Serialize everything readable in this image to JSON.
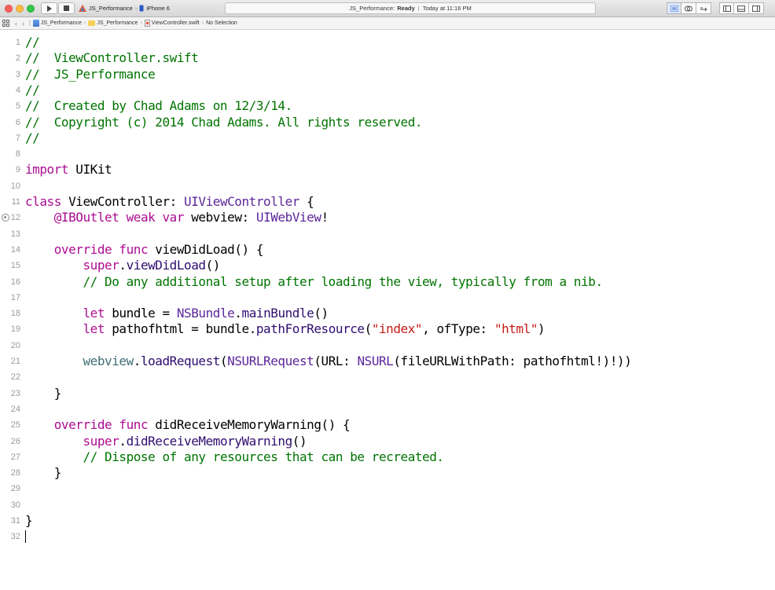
{
  "window": {
    "scheme_target": "JS_Performance",
    "scheme_device": "iPhone 6",
    "status_project": "JS_Performance:",
    "status_state": "Ready",
    "status_separator": "|",
    "status_time": "Today at 11:16 PM"
  },
  "jumpbar": {
    "crumbs": [
      "JS_Performance",
      "JS_Performance",
      "ViewController.swift",
      "No Selection"
    ]
  },
  "editor": {
    "lines": [
      {
        "n": "1",
        "t": [
          {
            "c": "cmt",
            "s": "//"
          }
        ]
      },
      {
        "n": "2",
        "t": [
          {
            "c": "cmt",
            "s": "//  ViewController.swift"
          }
        ]
      },
      {
        "n": "3",
        "t": [
          {
            "c": "cmt",
            "s": "//  JS_Performance"
          }
        ]
      },
      {
        "n": "4",
        "t": [
          {
            "c": "cmt",
            "s": "//"
          }
        ]
      },
      {
        "n": "5",
        "t": [
          {
            "c": "cmt",
            "s": "//  Created by Chad Adams on 12/3/14."
          }
        ]
      },
      {
        "n": "6",
        "t": [
          {
            "c": "cmt",
            "s": "//  Copyright (c) 2014 Chad Adams. All rights reserved."
          }
        ]
      },
      {
        "n": "7",
        "t": [
          {
            "c": "cmt",
            "s": "//"
          }
        ]
      },
      {
        "n": "8",
        "t": []
      },
      {
        "n": "9",
        "t": [
          {
            "c": "kw",
            "s": "import"
          },
          {
            "c": "txt",
            "s": " UIKit"
          }
        ]
      },
      {
        "n": "10",
        "t": []
      },
      {
        "n": "11",
        "t": [
          {
            "c": "kw",
            "s": "class"
          },
          {
            "c": "txt",
            "s": " ViewController: "
          },
          {
            "c": "typ",
            "s": "UIViewController"
          },
          {
            "c": "txt",
            "s": " {"
          }
        ]
      },
      {
        "n": "12",
        "t": [
          {
            "c": "txt",
            "s": "    "
          },
          {
            "c": "kw",
            "s": "@IBOutlet"
          },
          {
            "c": "txt",
            "s": " "
          },
          {
            "c": "kw",
            "s": "weak"
          },
          {
            "c": "txt",
            "s": " "
          },
          {
            "c": "kw",
            "s": "var"
          },
          {
            "c": "txt",
            "s": " webview: "
          },
          {
            "c": "typ",
            "s": "UIWebView"
          },
          {
            "c": "txt",
            "s": "!"
          }
        ],
        "outlet": true
      },
      {
        "n": "13",
        "t": []
      },
      {
        "n": "14",
        "t": [
          {
            "c": "txt",
            "s": "    "
          },
          {
            "c": "kw",
            "s": "override"
          },
          {
            "c": "txt",
            "s": " "
          },
          {
            "c": "kw",
            "s": "func"
          },
          {
            "c": "txt",
            "s": " viewDidLoad() {"
          }
        ]
      },
      {
        "n": "15",
        "t": [
          {
            "c": "txt",
            "s": "        "
          },
          {
            "c": "kw",
            "s": "super"
          },
          {
            "c": "txt",
            "s": "."
          },
          {
            "c": "mth",
            "s": "viewDidLoad"
          },
          {
            "c": "txt",
            "s": "()"
          }
        ]
      },
      {
        "n": "16",
        "t": [
          {
            "c": "txt",
            "s": "        "
          },
          {
            "c": "cmt",
            "s": "// Do any additional setup after loading the view, typically from a nib."
          }
        ]
      },
      {
        "n": "17",
        "t": []
      },
      {
        "n": "18",
        "t": [
          {
            "c": "txt",
            "s": "        "
          },
          {
            "c": "kw",
            "s": "let"
          },
          {
            "c": "txt",
            "s": " bundle = "
          },
          {
            "c": "typ",
            "s": "NSBundle"
          },
          {
            "c": "txt",
            "s": "."
          },
          {
            "c": "mth",
            "s": "mainBundle"
          },
          {
            "c": "txt",
            "s": "()"
          }
        ]
      },
      {
        "n": "19",
        "t": [
          {
            "c": "txt",
            "s": "        "
          },
          {
            "c": "kw",
            "s": "let"
          },
          {
            "c": "txt",
            "s": " pathofhtml = bundle."
          },
          {
            "c": "mth",
            "s": "pathForResource"
          },
          {
            "c": "txt",
            "s": "("
          },
          {
            "c": "str",
            "s": "\"index\""
          },
          {
            "c": "txt",
            "s": ", ofType: "
          },
          {
            "c": "str",
            "s": "\"html\""
          },
          {
            "c": "txt",
            "s": ")"
          }
        ]
      },
      {
        "n": "20",
        "t": []
      },
      {
        "n": "21",
        "t": [
          {
            "c": "txt",
            "s": "        "
          },
          {
            "c": "prj",
            "s": "webview"
          },
          {
            "c": "txt",
            "s": "."
          },
          {
            "c": "mth",
            "s": "loadRequest"
          },
          {
            "c": "txt",
            "s": "("
          },
          {
            "c": "typ",
            "s": "NSURLRequest"
          },
          {
            "c": "txt",
            "s": "(URL: "
          },
          {
            "c": "typ",
            "s": "NSURL"
          },
          {
            "c": "txt",
            "s": "(fileURLWithPath: pathofhtml!)!))"
          }
        ]
      },
      {
        "n": "22",
        "t": []
      },
      {
        "n": "23",
        "t": [
          {
            "c": "txt",
            "s": "    }"
          }
        ]
      },
      {
        "n": "24",
        "t": []
      },
      {
        "n": "25",
        "t": [
          {
            "c": "txt",
            "s": "    "
          },
          {
            "c": "kw",
            "s": "override"
          },
          {
            "c": "txt",
            "s": " "
          },
          {
            "c": "kw",
            "s": "func"
          },
          {
            "c": "txt",
            "s": " didReceiveMemoryWarning() {"
          }
        ]
      },
      {
        "n": "26",
        "t": [
          {
            "c": "txt",
            "s": "        "
          },
          {
            "c": "kw",
            "s": "super"
          },
          {
            "c": "txt",
            "s": "."
          },
          {
            "c": "mth",
            "s": "didReceiveMemoryWarning"
          },
          {
            "c": "txt",
            "s": "()"
          }
        ]
      },
      {
        "n": "27",
        "t": [
          {
            "c": "txt",
            "s": "        "
          },
          {
            "c": "cmt",
            "s": "// Dispose of any resources that can be recreated."
          }
        ]
      },
      {
        "n": "28",
        "t": [
          {
            "c": "txt",
            "s": "    }"
          }
        ]
      },
      {
        "n": "29",
        "t": []
      },
      {
        "n": "30",
        "t": []
      },
      {
        "n": "31",
        "t": [
          {
            "c": "txt",
            "s": "}"
          }
        ]
      },
      {
        "n": "32",
        "t": [],
        "cursor": true
      }
    ]
  },
  "colors": {
    "comment": "#007400",
    "keyword": "#aa0d91",
    "type": "#5c2699",
    "method": "#2e0d6e",
    "project": "#3f6e74",
    "string": "#c41a16"
  }
}
